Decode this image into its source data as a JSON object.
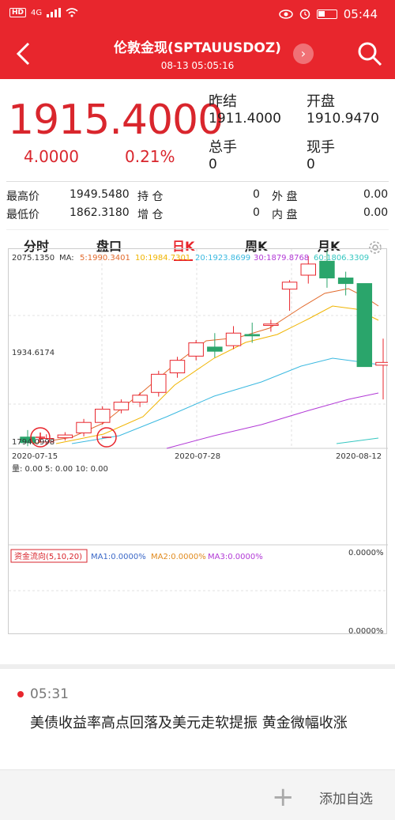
{
  "status": {
    "network": "4G",
    "time": "05:44"
  },
  "header": {
    "title": "伦敦金现(SPTAUUSDOZ)",
    "datetime": "08-13 05:05:16"
  },
  "quote": {
    "price": "1915.4000",
    "change": "4.0000",
    "change_pct": "0.21%",
    "prev_close_label": "昨结",
    "prev_close": "1911.4000",
    "open_label": "开盘",
    "open": "1910.9470",
    "total_vol_label": "总手",
    "total_vol": "0",
    "cur_vol_label": "现手",
    "cur_vol": "0"
  },
  "stats": {
    "high_label": "最高价",
    "high": "1949.5480",
    "low_label": "最低价",
    "low": "1862.3180",
    "hold_label": "持  仓",
    "hold": "0",
    "add_label": "增  仓",
    "add": "0",
    "outer_label": "外  盘",
    "outer": "0.00",
    "inner_label": "内  盘",
    "inner": "0.00"
  },
  "tabs": [
    "分时",
    "盘口",
    "日K",
    "周K",
    "月K"
  ],
  "active_tab": "日K",
  "chart": {
    "y_max_label": "2075.1350",
    "y_mid_label": "1934.6174",
    "y_min_label": "1794.0998",
    "ma_label": "MA:",
    "ma5": "5:1990.3401",
    "ma10": "10:1984.7301",
    "ma20": "20:1923.8699",
    "ma30": "30:1879.8768",
    "ma60": "60:1806.3309",
    "x_labels": [
      "2020-07-15",
      "2020-07-28",
      "2020-08-12"
    ],
    "volume_label": "量: 0.00  5: 0.00  10: 0.00",
    "flow_label": "资金流向(5,10,20)",
    "flow_ma1": "MA1:0.0000%",
    "flow_ma2": "MA2:0.0000%",
    "flow_ma3": "MA3:0.0000%",
    "flow_top": "0.0000%",
    "flow_bottom": "0.0000%"
  },
  "colors": {
    "up": "#e8262d",
    "down": "#2aa56b",
    "ma5": "#e26a2c",
    "ma10": "#f0b400",
    "ma20": "#3bb9e0",
    "ma30": "#b23ad6",
    "ma60": "#36c7c1"
  },
  "news": {
    "time": "05:31",
    "text": "美债收益率高点回落及美元走软提振 黄金微幅收涨"
  },
  "footer": {
    "add_label": "添加自选"
  },
  "chart_data": {
    "type": "candlestick",
    "x_labels": [
      "2020-07-15",
      "2020-07-28",
      "2020-08-12"
    ],
    "ylim": [
      1794.0998,
      2075.135
    ],
    "candles": [
      {
        "o": 1808,
        "c": 1800,
        "h": 1818,
        "l": 1795
      },
      {
        "o": 1801,
        "c": 1806,
        "h": 1812,
        "l": 1797
      },
      {
        "o": 1807,
        "c": 1811,
        "h": 1815,
        "l": 1803
      },
      {
        "o": 1814,
        "c": 1829,
        "h": 1834,
        "l": 1809
      },
      {
        "o": 1829,
        "c": 1848,
        "h": 1852,
        "l": 1826
      },
      {
        "o": 1847,
        "c": 1858,
        "h": 1862,
        "l": 1842
      },
      {
        "o": 1858,
        "c": 1868,
        "h": 1872,
        "l": 1851
      },
      {
        "o": 1872,
        "c": 1898,
        "h": 1903,
        "l": 1866
      },
      {
        "o": 1900,
        "c": 1918,
        "h": 1923,
        "l": 1893
      },
      {
        "o": 1924,
        "c": 1943,
        "h": 1947,
        "l": 1918
      },
      {
        "o": 1937,
        "c": 1931,
        "h": 1957,
        "l": 1922
      },
      {
        "o": 1939,
        "c": 1957,
        "h": 1967,
        "l": 1934
      },
      {
        "o": 1955,
        "c": 1953,
        "h": 1972,
        "l": 1943
      },
      {
        "o": 1968,
        "c": 1970,
        "h": 1976,
        "l": 1959
      },
      {
        "o": 2020,
        "c": 2030,
        "h": 2033,
        "l": 1989
      },
      {
        "o": 2040,
        "c": 2056,
        "h": 2067,
        "l": 2028
      },
      {
        "o": 2060,
        "c": 2036,
        "h": 2075,
        "l": 2022
      },
      {
        "o": 2036,
        "c": 2028,
        "h": 2045,
        "l": 2011
      },
      {
        "o": 2028,
        "c": 1909,
        "h": 2028,
        "l": 1909
      },
      {
        "o": 1911,
        "c": 1915,
        "h": 1949,
        "l": 1862
      }
    ]
  }
}
